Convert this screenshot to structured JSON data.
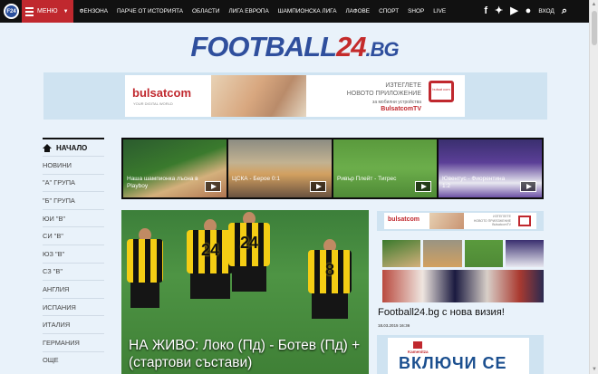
{
  "topbar": {
    "logo": "F24",
    "menu_label": "МЕНЮ",
    "nav": [
      "ФЕНЗОНА",
      "ПАРЧЕ ОТ ИСТОРИЯТА",
      "ОБЛАСТИ",
      "ЛИГА ЕВРОПА",
      "ШАМПИОНСКА ЛИГА",
      "ЛАФОВЕ",
      "СПОРТ",
      "SHOP",
      "LIVE"
    ],
    "login_label": "ВХОД"
  },
  "brand": {
    "part1": "FOOTBALL",
    "part2": "24",
    "part3": ".BG"
  },
  "banner": {
    "logo": "bulsatcom",
    "logo_sub": "YOUR DIGITAL WORLD",
    "title_line1": "ИЗТЕГЛЕТЕ",
    "title_line2": "НОВОТО ПРИЛОЖЕНИЕ",
    "sub": "за мобилни устройства",
    "tv": "BulsatcomTV",
    "device": "bulsat com"
  },
  "sidebar": {
    "home": "НАЧАЛО",
    "items": [
      "НОВИНИ",
      "\"А\" ГРУПА",
      "\"Б\" ГРУПА",
      "ЮИ \"В\"",
      "СИ \"В\"",
      "ЮЗ \"В\"",
      "СЗ \"В\"",
      "АНГЛИЯ",
      "ИСПАНИЯ",
      "ИТАЛИЯ",
      "ГЕРМАНИЯ",
      "ОЩЕ"
    ]
  },
  "videos": [
    {
      "caption": "Наша шампионка лъсна в Playboy"
    },
    {
      "caption": "ЦСКА - Берое 0:1"
    },
    {
      "caption": "Ривър Плейт - Тигрес"
    },
    {
      "caption": "Ювентус - Фиорентина 1:2"
    }
  ],
  "main": {
    "headline": "НА ЖИВО: Локо (Пд) - Ботев (Пд) + (стартови състави)",
    "player_numbers": [
      "24",
      "24",
      "8"
    ]
  },
  "right": {
    "title": "Football24.bg с нова визия!",
    "date": "18.03.2015 16:36",
    "ad_brand": "Kamenitza",
    "ad_text": "ВКЛЮЧИ СЕ"
  },
  "colors": {
    "accent": "#c0282e",
    "brand_blue": "#2f4f9d",
    "background": "#e9f2fa"
  }
}
